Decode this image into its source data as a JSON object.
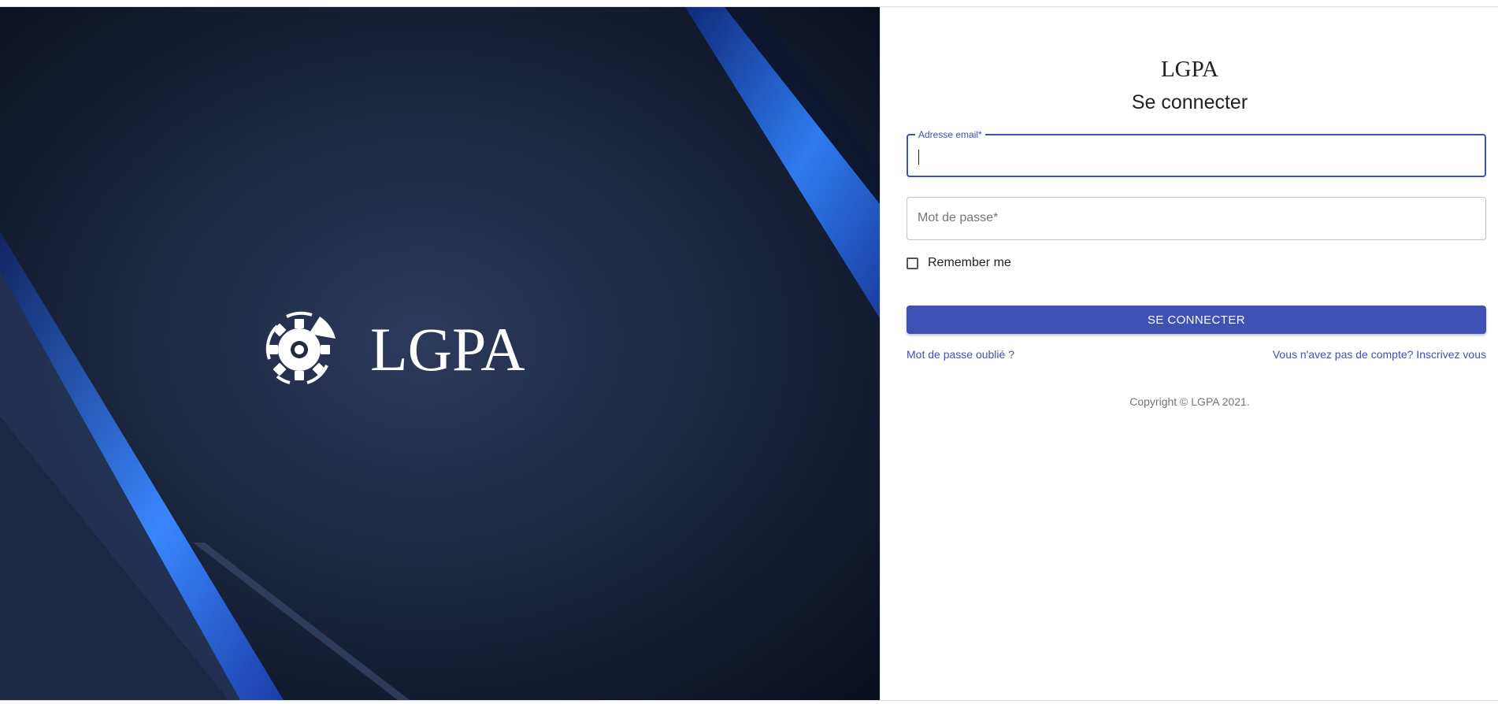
{
  "brand": {
    "name": "LGPA",
    "icon": "gear-logo-icon"
  },
  "login": {
    "app_name": "LGPA",
    "heading": "Se connecter",
    "email": {
      "label": "Adresse email",
      "required_mark": "*",
      "value": ""
    },
    "password": {
      "label": "Mot de passe",
      "required_mark": "*",
      "value": ""
    },
    "remember_label": "Remember me",
    "remember_checked": false,
    "submit_label": "SE CONNECTER",
    "forgot_link": "Mot de passe oublié ?",
    "signup_link": "Vous n'avez pas de compte? Inscrivez vous",
    "copyright": "Copyright © LGPA 2021."
  },
  "colors": {
    "primary": "#3f51b5",
    "hero_dark": "#131b30",
    "hero_accent": "#2f7bf0"
  }
}
